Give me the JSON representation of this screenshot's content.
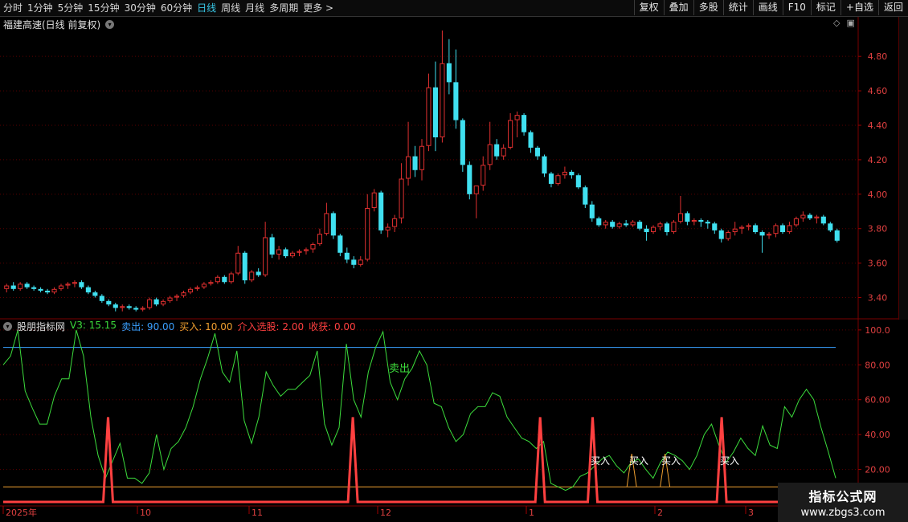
{
  "toolbar": {
    "periods": [
      "分时",
      "1分钟",
      "5分钟",
      "15分钟",
      "30分钟",
      "60分钟",
      "日线",
      "周线",
      "月线",
      "多周期",
      "更多 >"
    ],
    "active_period": "日线",
    "buttons": [
      "复权",
      "叠加",
      "多股",
      "统计",
      "画线",
      "F10",
      "标记",
      "+自选",
      "返回"
    ]
  },
  "main_chart": {
    "title": "福建高速(日线 前复权)",
    "y_ticks": [
      "4.80",
      "4.60",
      "4.40",
      "4.20",
      "4.00",
      "3.80",
      "3.60",
      "3.40"
    ],
    "up_color": "#e03030",
    "down_color": "#40e0f0"
  },
  "indicator": {
    "name": "股朋指标网",
    "values": [
      {
        "label": "V3: 15.15",
        "color": "#3cdc3c"
      },
      {
        "label": "卖出: 90.00",
        "color": "#3aa0ff"
      },
      {
        "label": "买入: 10.00",
        "color": "#f0a030"
      },
      {
        "label": "介入选股: 2.00",
        "color": "#ff4040"
      },
      {
        "label": "收获: 0.00",
        "color": "#ff4040"
      }
    ],
    "y_ticks": [
      "100.0",
      "80.00",
      "60.00",
      "40.00",
      "20.00"
    ],
    "sell_label": "卖出",
    "buy_label": "买入"
  },
  "x_axis": {
    "labels": [
      "2025年",
      "10",
      "11",
      "12",
      "1",
      "2",
      "3"
    ]
  },
  "chart_data": [
    {
      "type": "candlestick",
      "title": "福建高速(日线 前复权)",
      "ylim": [
        3.3,
        4.95
      ],
      "candles": [
        [
          3.45,
          3.48,
          3.43,
          3.47
        ],
        [
          3.47,
          3.49,
          3.44,
          3.45
        ],
        [
          3.45,
          3.49,
          3.44,
          3.48
        ],
        [
          3.48,
          3.49,
          3.45,
          3.46
        ],
        [
          3.46,
          3.47,
          3.44,
          3.45
        ],
        [
          3.45,
          3.46,
          3.43,
          3.44
        ],
        [
          3.44,
          3.45,
          3.42,
          3.43
        ],
        [
          3.43,
          3.46,
          3.42,
          3.45
        ],
        [
          3.45,
          3.48,
          3.44,
          3.47
        ],
        [
          3.47,
          3.49,
          3.45,
          3.48
        ],
        [
          3.48,
          3.5,
          3.46,
          3.49
        ],
        [
          3.49,
          3.5,
          3.45,
          3.46
        ],
        [
          3.46,
          3.47,
          3.42,
          3.43
        ],
        [
          3.43,
          3.44,
          3.4,
          3.41
        ],
        [
          3.41,
          3.42,
          3.37,
          3.38
        ],
        [
          3.38,
          3.39,
          3.35,
          3.36
        ],
        [
          3.36,
          3.37,
          3.32,
          3.34
        ],
        [
          3.34,
          3.36,
          3.32,
          3.35
        ],
        [
          3.35,
          3.36,
          3.33,
          3.34
        ],
        [
          3.34,
          3.35,
          3.32,
          3.33
        ],
        [
          3.33,
          3.35,
          3.32,
          3.34
        ],
        [
          3.34,
          3.4,
          3.33,
          3.39
        ],
        [
          3.39,
          3.4,
          3.35,
          3.36
        ],
        [
          3.36,
          3.39,
          3.35,
          3.38
        ],
        [
          3.38,
          3.41,
          3.37,
          3.4
        ],
        [
          3.4,
          3.42,
          3.38,
          3.41
        ],
        [
          3.41,
          3.44,
          3.4,
          3.43
        ],
        [
          3.43,
          3.46,
          3.42,
          3.45
        ],
        [
          3.45,
          3.47,
          3.44,
          3.46
        ],
        [
          3.46,
          3.49,
          3.45,
          3.48
        ],
        [
          3.48,
          3.5,
          3.47,
          3.49
        ],
        [
          3.49,
          3.53,
          3.48,
          3.52
        ],
        [
          3.52,
          3.53,
          3.48,
          3.49
        ],
        [
          3.49,
          3.55,
          3.48,
          3.54
        ],
        [
          3.54,
          3.7,
          3.53,
          3.66
        ],
        [
          3.66,
          3.67,
          3.48,
          3.5
        ],
        [
          3.5,
          3.56,
          3.49,
          3.55
        ],
        [
          3.55,
          3.57,
          3.52,
          3.53
        ],
        [
          3.53,
          3.84,
          3.52,
          3.75
        ],
        [
          3.75,
          3.77,
          3.63,
          3.65
        ],
        [
          3.65,
          3.7,
          3.62,
          3.68
        ],
        [
          3.68,
          3.69,
          3.63,
          3.64
        ],
        [
          3.64,
          3.67,
          3.63,
          3.66
        ],
        [
          3.66,
          3.68,
          3.64,
          3.67
        ],
        [
          3.67,
          3.69,
          3.65,
          3.68
        ],
        [
          3.68,
          3.72,
          3.66,
          3.71
        ],
        [
          3.71,
          3.8,
          3.7,
          3.77
        ],
        [
          3.77,
          3.95,
          3.76,
          3.89
        ],
        [
          3.89,
          3.9,
          3.74,
          3.76
        ],
        [
          3.76,
          3.77,
          3.64,
          3.66
        ],
        [
          3.66,
          3.69,
          3.6,
          3.62
        ],
        [
          3.62,
          3.64,
          3.57,
          3.59
        ],
        [
          3.59,
          3.64,
          3.58,
          3.62
        ],
        [
          3.62,
          4.0,
          3.61,
          3.92
        ],
        [
          3.92,
          4.03,
          3.9,
          4.01
        ],
        [
          4.01,
          4.02,
          3.77,
          3.79
        ],
        [
          3.79,
          3.83,
          3.75,
          3.81
        ],
        [
          3.81,
          3.88,
          3.78,
          3.86
        ],
        [
          3.86,
          4.18,
          3.83,
          4.09
        ],
        [
          4.09,
          4.42,
          4.05,
          4.22
        ],
        [
          4.22,
          4.28,
          4.1,
          4.14
        ],
        [
          4.14,
          4.32,
          4.08,
          4.28
        ],
        [
          4.28,
          4.7,
          4.25,
          4.62
        ],
        [
          4.62,
          4.77,
          4.25,
          4.33
        ],
        [
          4.33,
          4.95,
          4.3,
          4.76
        ],
        [
          4.76,
          4.9,
          4.58,
          4.65
        ],
        [
          4.65,
          4.84,
          4.38,
          4.43
        ],
        [
          4.43,
          4.44,
          4.13,
          4.17
        ],
        [
          4.17,
          4.19,
          3.97,
          4.0
        ],
        [
          4.0,
          4.05,
          3.86,
          4.05
        ],
        [
          4.05,
          4.22,
          4.02,
          4.17
        ],
        [
          4.17,
          4.42,
          4.14,
          4.29
        ],
        [
          4.29,
          4.32,
          4.2,
          4.22
        ],
        [
          4.22,
          4.29,
          4.2,
          4.27
        ],
        [
          4.27,
          4.47,
          4.26,
          4.43
        ],
        [
          4.43,
          4.48,
          4.33,
          4.46
        ],
        [
          4.46,
          4.47,
          4.34,
          4.36
        ],
        [
          4.36,
          4.37,
          4.24,
          4.27
        ],
        [
          4.27,
          4.28,
          4.2,
          4.22
        ],
        [
          4.22,
          4.23,
          4.1,
          4.12
        ],
        [
          4.12,
          4.13,
          4.04,
          4.06
        ],
        [
          4.06,
          4.12,
          4.05,
          4.11
        ],
        [
          4.11,
          4.16,
          4.09,
          4.13
        ],
        [
          4.13,
          4.14,
          4.09,
          4.11
        ],
        [
          4.11,
          4.12,
          4.03,
          4.04
        ],
        [
          4.04,
          4.05,
          3.92,
          3.94
        ],
        [
          3.94,
          3.96,
          3.84,
          3.86
        ],
        [
          3.86,
          3.87,
          3.81,
          3.82
        ],
        [
          3.82,
          3.85,
          3.8,
          3.84
        ],
        [
          3.84,
          3.85,
          3.8,
          3.81
        ],
        [
          3.81,
          3.84,
          3.8,
          3.83
        ],
        [
          3.83,
          3.85,
          3.81,
          3.82
        ],
        [
          3.82,
          3.85,
          3.81,
          3.84
        ],
        [
          3.84,
          3.85,
          3.79,
          3.8
        ],
        [
          3.8,
          3.82,
          3.73,
          3.78
        ],
        [
          3.78,
          3.82,
          3.77,
          3.81
        ],
        [
          3.81,
          3.84,
          3.79,
          3.83
        ],
        [
          3.83,
          3.84,
          3.76,
          3.78
        ],
        [
          3.78,
          3.85,
          3.77,
          3.84
        ],
        [
          3.84,
          3.99,
          3.83,
          3.89
        ],
        [
          3.89,
          3.9,
          3.82,
          3.84
        ],
        [
          3.84,
          3.86,
          3.82,
          3.85
        ],
        [
          3.85,
          3.86,
          3.81,
          3.84
        ],
        [
          3.84,
          3.85,
          3.8,
          3.83
        ],
        [
          3.83,
          3.84,
          3.77,
          3.79
        ],
        [
          3.79,
          3.8,
          3.72,
          3.74
        ],
        [
          3.74,
          3.79,
          3.73,
          3.78
        ],
        [
          3.78,
          3.84,
          3.76,
          3.8
        ],
        [
          3.8,
          3.82,
          3.77,
          3.81
        ],
        [
          3.81,
          3.83,
          3.79,
          3.82
        ],
        [
          3.82,
          3.83,
          3.77,
          3.78
        ],
        [
          3.78,
          3.79,
          3.66,
          3.76
        ],
        [
          3.76,
          3.78,
          3.74,
          3.77
        ],
        [
          3.77,
          3.83,
          3.75,
          3.82
        ],
        [
          3.82,
          3.83,
          3.77,
          3.78
        ],
        [
          3.78,
          3.84,
          3.77,
          3.82
        ],
        [
          3.82,
          3.87,
          3.81,
          3.86
        ],
        [
          3.86,
          3.9,
          3.84,
          3.88
        ],
        [
          3.88,
          3.89,
          3.85,
          3.86
        ],
        [
          3.86,
          3.88,
          3.83,
          3.87
        ],
        [
          3.87,
          3.88,
          3.82,
          3.83
        ],
        [
          3.83,
          3.84,
          3.78,
          3.79
        ],
        [
          3.79,
          3.8,
          3.72,
          3.73
        ]
      ]
    },
    {
      "type": "line",
      "series": [
        {
          "name": "V3",
          "color": "#3cdc3c",
          "values": [
            80,
            85,
            100,
            65,
            55,
            46,
            46,
            62,
            72,
            72,
            100,
            85,
            50,
            28,
            15,
            25,
            35,
            15,
            15,
            12,
            18,
            40,
            20,
            32,
            36,
            44,
            56,
            72,
            84,
            98,
            76,
            70,
            88,
            48,
            35,
            50,
            76,
            68,
            62,
            66,
            66,
            70,
            74,
            88,
            46,
            34,
            44,
            92,
            60,
            50,
            76,
            90,
            99,
            70,
            60,
            72,
            78,
            88,
            80,
            58,
            56,
            44,
            36,
            40,
            52,
            56,
            56,
            64,
            62,
            50,
            44,
            38,
            36,
            32,
            36,
            12,
            10,
            8,
            10,
            16,
            18,
            22,
            26,
            28,
            22,
            18,
            24,
            26,
            20,
            15,
            24,
            30,
            28,
            25,
            20,
            28,
            40,
            46,
            34,
            24,
            30,
            38,
            32,
            28,
            45,
            34,
            32,
            56,
            50,
            60,
            66,
            60,
            44,
            30,
            15
          ]
        },
        {
          "name": "卖出",
          "color": "#3aa0ff",
          "values": [
            90
          ]
        },
        {
          "name": "买入",
          "color": "#f0a030",
          "values": [
            10
          ]
        },
        {
          "name": "介入选股",
          "color": "#ff4040",
          "values": [
            2
          ]
        },
        {
          "name": "收获",
          "color": "#ff4040",
          "values": [
            0
          ]
        }
      ],
      "ylim": [
        0,
        105
      ]
    }
  ]
}
